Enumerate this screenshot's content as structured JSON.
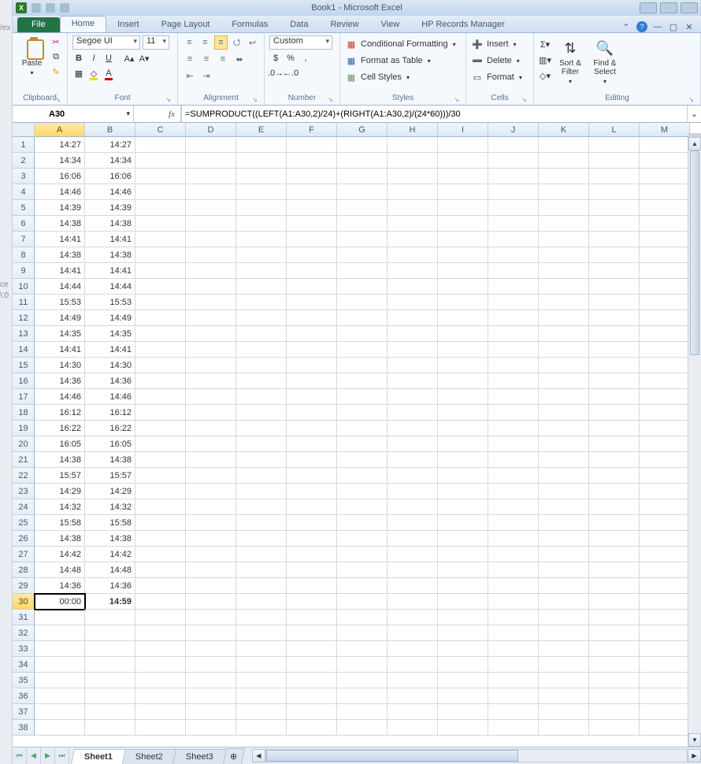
{
  "titlebar": {
    "doc": "Book1 - Microsoft Excel"
  },
  "tabs": {
    "file": "File",
    "items": [
      "Home",
      "Insert",
      "Page Layout",
      "Formulas",
      "Data",
      "Review",
      "View",
      "HP Records Manager"
    ],
    "active": 0
  },
  "ribbon": {
    "clipboard": {
      "label": "Clipboard",
      "paste": "Paste"
    },
    "font": {
      "label": "Font",
      "name": "Segoe UI",
      "size": "11"
    },
    "alignment": {
      "label": "Alignment"
    },
    "number": {
      "label": "Number",
      "format": "Custom"
    },
    "styles": {
      "label": "Styles",
      "cond": "Conditional Formatting",
      "table": "Format as Table",
      "cell": "Cell Styles"
    },
    "cells": {
      "label": "Cells",
      "insert": "Insert",
      "delete": "Delete",
      "format": "Format"
    },
    "editing": {
      "label": "Editing",
      "sort": "Sort & Filter",
      "find": "Find & Select"
    }
  },
  "namebox": "A30",
  "formula": "=SUMPRODUCT((LEFT(A1:A30,2)/24)+(RIGHT(A1:A30,2)/(24*60)))/30",
  "columns": [
    "A",
    "B",
    "C",
    "D",
    "E",
    "F",
    "G",
    "H",
    "I",
    "J",
    "K",
    "L",
    "M"
  ],
  "rows": 38,
  "active_cell": {
    "row": 30,
    "col": "A"
  },
  "data": {
    "A": [
      "14:27",
      "14:34",
      "16:06",
      "14:46",
      "14:39",
      "14:38",
      "14:41",
      "14:38",
      "14:41",
      "14:44",
      "15:53",
      "14:49",
      "14:35",
      "14:41",
      "14:30",
      "14:36",
      "14:46",
      "16:12",
      "16:22",
      "16:05",
      "14:38",
      "15:57",
      "14:29",
      "14:32",
      "15:58",
      "14:38",
      "14:42",
      "14:48",
      "14:36",
      "00:00"
    ],
    "B": [
      "14:27",
      "14:34",
      "16:06",
      "14:46",
      "14:39",
      "14:38",
      "14:41",
      "14:38",
      "14:41",
      "14:44",
      "15:53",
      "14:49",
      "14:35",
      "14:41",
      "14:30",
      "14:36",
      "14:46",
      "16:12",
      "16:22",
      "16:05",
      "14:38",
      "15:57",
      "14:29",
      "14:32",
      "15:58",
      "14:38",
      "14:42",
      "14:48",
      "14:36",
      "14:59"
    ]
  },
  "bold_cells": [
    "B30"
  ],
  "sheets": {
    "items": [
      "Sheet1",
      "Sheet2",
      "Sheet3"
    ],
    "active": 0
  },
  "left_fragments": [
    "/ex",
    "ce",
    "\\:0"
  ]
}
